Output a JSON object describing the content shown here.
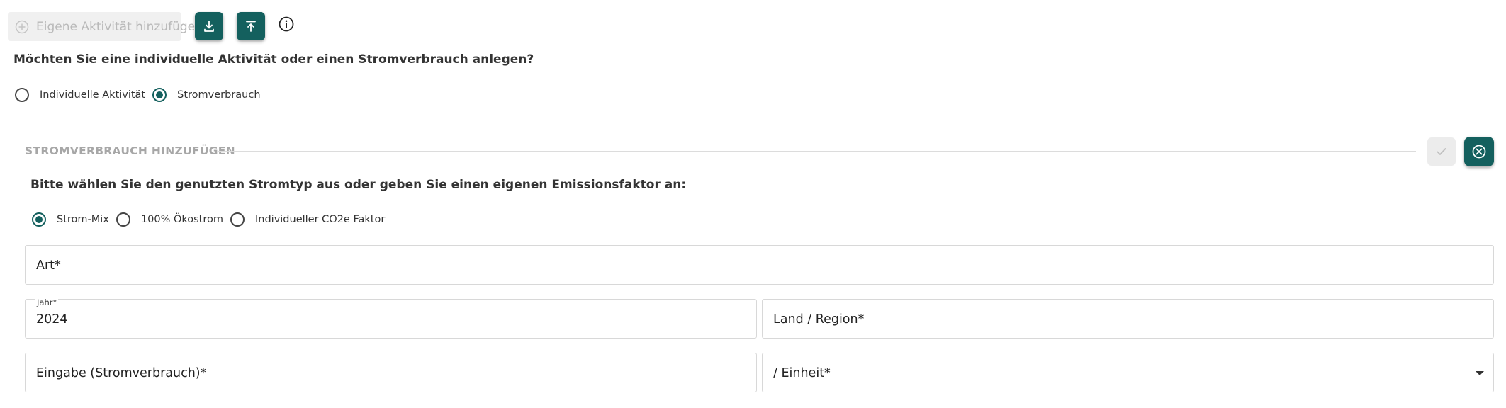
{
  "toolbar": {
    "add_activity_label": "Eigene Aktivität hinzufügen",
    "download_icon": "download-icon",
    "upload_icon": "upload-icon",
    "info_icon": "info-icon"
  },
  "question": "Möchten Sie eine individuelle Aktivität oder einen Stromverbrauch anlegen?",
  "type_options": [
    {
      "label": "Individuelle Aktivität",
      "checked": false
    },
    {
      "label": "Stromverbrauch",
      "checked": true
    }
  ],
  "section": {
    "title": "STROMVERBRAUCH HINZUFÜGEN",
    "confirm_icon": "check-icon",
    "cancel_icon": "close-circle-icon"
  },
  "prompt": "Bitte wählen Sie den genutzten Stromtyp aus oder geben Sie einen eigenen Emissionsfaktor an:",
  "power_options": [
    {
      "label": "Strom-Mix",
      "checked": true
    },
    {
      "label": "100% Ökostrom",
      "checked": false
    },
    {
      "label": "Individueller CO2e Faktor",
      "checked": false
    }
  ],
  "fields": {
    "art": {
      "placeholder": "Art*"
    },
    "jahr": {
      "label": "Jahr*",
      "value": "2024"
    },
    "land": {
      "placeholder": "Land / Region*"
    },
    "eingabe": {
      "placeholder": "Eingabe (Stromverbrauch)*"
    },
    "einheit": {
      "placeholder": "/ Einheit*"
    }
  },
  "colors": {
    "accent": "#14605e",
    "disabled_bg": "#f0f0f0",
    "section_title": "#a7a7a7"
  }
}
